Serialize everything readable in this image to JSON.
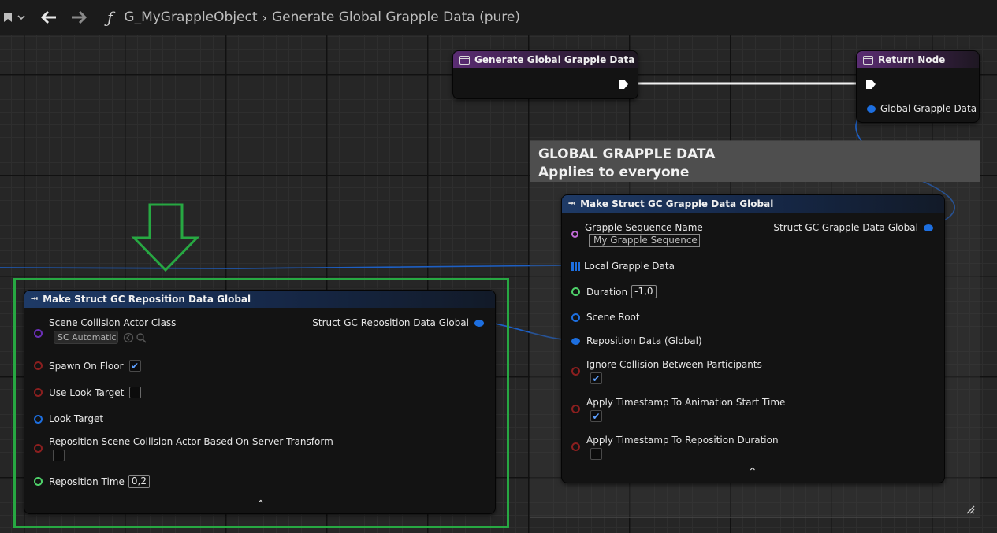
{
  "breadcrumb": {
    "function_glyph": "ƒ",
    "object_name": "G_MyGrappleObject",
    "function_name": "Generate Global Grapple Data (pure)"
  },
  "comment": {
    "line1": "GLOBAL GRAPPLE DATA",
    "line2": "Applies to everyone"
  },
  "nodes": {
    "entry": {
      "title": "Generate Global Grapple Data"
    },
    "return": {
      "title": "Return Node",
      "pin_global": "Global Grapple Data"
    },
    "make_global": {
      "title": "Make Struct GC Grapple Data Global",
      "output": "Struct GC Grapple Data Global",
      "pin_seq_name": "Grapple Sequence Name",
      "seq_value": "My Grapple Sequence",
      "pin_local": "Local Grapple Data",
      "pin_duration": "Duration",
      "duration_value": "-1,0",
      "pin_scene_root": "Scene Root",
      "pin_reposition": "Reposition Data (Global)",
      "pin_ignore": "Ignore Collision Between Participants",
      "pin_apply_anim": "Apply Timestamp To Animation Start Time",
      "pin_apply_repos": "Apply Timestamp To Reposition Duration"
    },
    "make_reposition": {
      "title": "Make Struct GC Reposition Data Global",
      "output": "Struct GC Reposition Data Global",
      "pin_scene_class": "Scene Collision Actor Class",
      "scene_class_value": "SC Automatic",
      "pin_spawn": "Spawn On Floor",
      "pin_use_look": "Use Look Target",
      "pin_look": "Look Target",
      "pin_server": "Reposition Scene Collision Actor Based On Server Transform",
      "pin_time": "Reposition Time",
      "time_value": "0,2"
    }
  },
  "colors": {
    "struct_pin": "#1d6fe0",
    "bool_pin": "#8b1f1f",
    "float_pin": "#4fd26a",
    "name_pin": "#c16ad6",
    "class_pin": "#6a2fb5",
    "highlight": "#27a842"
  }
}
